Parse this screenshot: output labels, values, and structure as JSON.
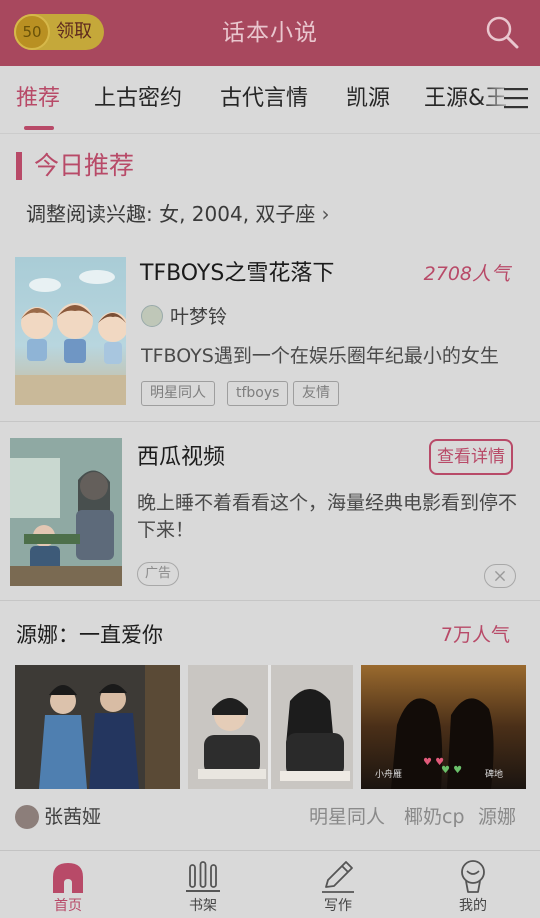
{
  "colors": {
    "header": "#a8485e",
    "accent": "#b84a68",
    "background": "#d9d9d9"
  },
  "header": {
    "coin_value": "50",
    "claim_label": "领取",
    "title": "话本小说",
    "search_icon": "search-icon"
  },
  "tabs": [
    {
      "label": "推荐",
      "active": true
    },
    {
      "label": "上古密约"
    },
    {
      "label": "古代言情"
    },
    {
      "label": "凯源"
    },
    {
      "label": "王源&王"
    }
  ],
  "recommend": {
    "section_title": "今日推荐",
    "interest_text": "调整阅读兴趣: 女, 2004, 双子座",
    "chevron": "›"
  },
  "book": {
    "title": "TFBOYS之雪花落下",
    "popularity": "2708人气",
    "author": "叶梦铃",
    "description": "TFBOYS遇到一个在娱乐圈年纪最小的女生",
    "tags": [
      "明星同人",
      "tfboys",
      "友情"
    ]
  },
  "ad": {
    "title": "西瓜视频",
    "detail_button": "查看详情",
    "description": "晚上睡不着看看这个，海量经典电影看到停不下来！",
    "badge": "广告"
  },
  "collection": {
    "title": "源娜：一直爱你",
    "popularity": "7万人气",
    "author": "张茜娅",
    "tags": [
      "明星同人",
      "椰奶cp",
      "源娜"
    ],
    "photo3_caption_left": "小舟雁",
    "photo3_caption_right": "碑地"
  },
  "bottom_nav": [
    {
      "label": "首页",
      "icon": "home-icon",
      "active": true
    },
    {
      "label": "书架",
      "icon": "bookshelf-icon"
    },
    {
      "label": "写作",
      "icon": "pen-icon"
    },
    {
      "label": "我的",
      "icon": "profile-icon"
    }
  ]
}
